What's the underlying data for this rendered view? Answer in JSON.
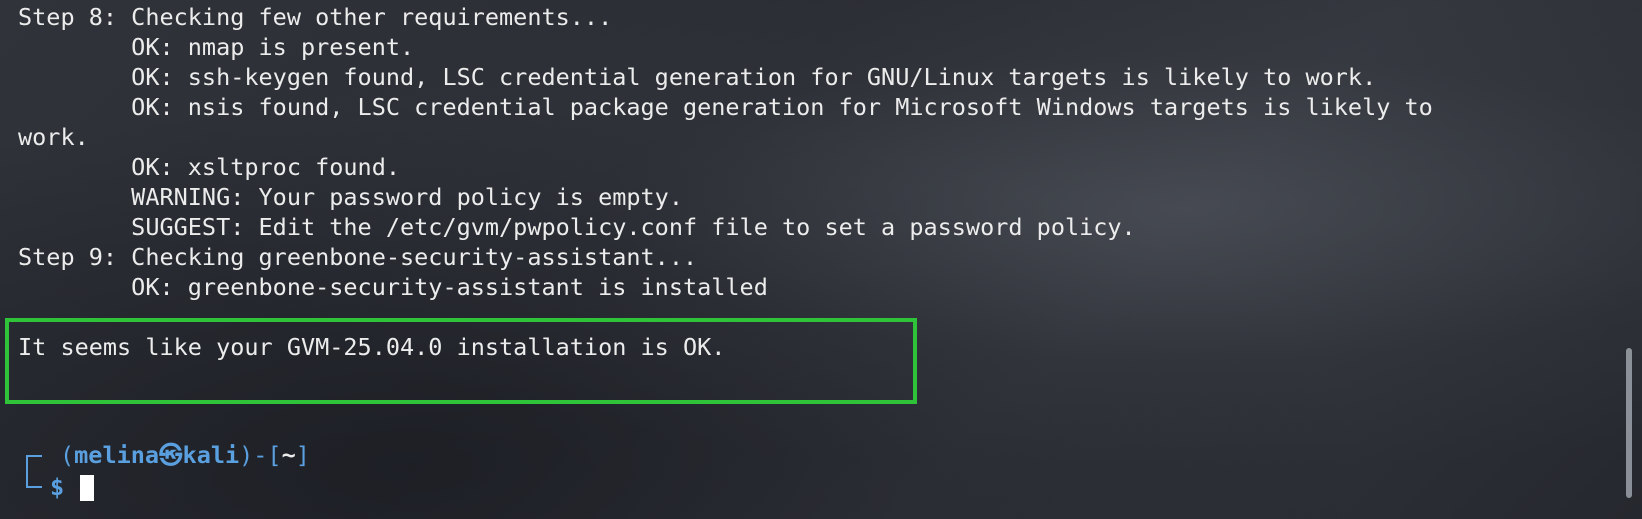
{
  "terminal": {
    "lines": [
      "Step 8: Checking few other requirements...",
      "        OK: nmap is present.",
      "        OK: ssh-keygen found, LSC credential generation for GNU/Linux targets is likely to work.",
      "        OK: nsis found, LSC credential package generation for Microsoft Windows targets is likely to",
      "work.",
      "        OK: xsltproc found.",
      "        WARNING: Your password policy is empty.",
      "        SUGGEST: Edit the /etc/gvm/pwpolicy.conf file to set a password policy.",
      "Step 9: Checking greenbone-security-assistant...",
      "        OK: greenbone-security-assistant is installed"
    ],
    "result_message": "It seems like your GVM-25.04.0 installation is OK.",
    "prompt": {
      "open_paren": "(",
      "user": "melina",
      "at_symbol": "㉿",
      "host": "kali",
      "close_part": ")-[",
      "cwd": "~",
      "close_bracket": "]",
      "symbol": "$"
    }
  },
  "colors": {
    "highlight_box": "#2fc33a",
    "prompt_accent": "#5aa0e0",
    "text": "#ececec"
  }
}
